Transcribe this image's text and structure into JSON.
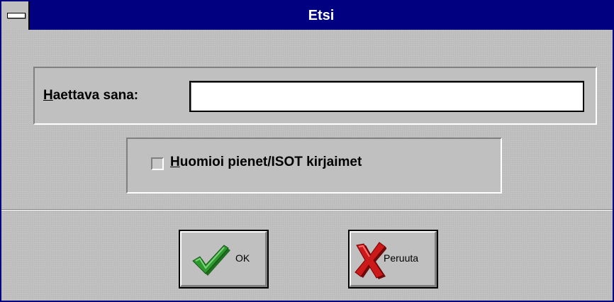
{
  "window": {
    "title": "Etsi"
  },
  "search": {
    "label_access": "H",
    "label_rest": "aettava sana:",
    "value": ""
  },
  "case_option": {
    "label_access": "H",
    "label_rest": "uomioi pienet/ISOT kirjaimet",
    "checked": false
  },
  "buttons": {
    "ok_label": "OK",
    "cancel_label": "Peruuta"
  },
  "icons": {
    "system_menu": "system-menu-icon",
    "ok": "green-checkmark-icon",
    "cancel": "red-x-icon"
  },
  "colors": {
    "titlebar": "#000080",
    "face": "#c0c0c0",
    "ok_icon": "#2e9a2e",
    "cancel_icon": "#cc1a1a"
  }
}
